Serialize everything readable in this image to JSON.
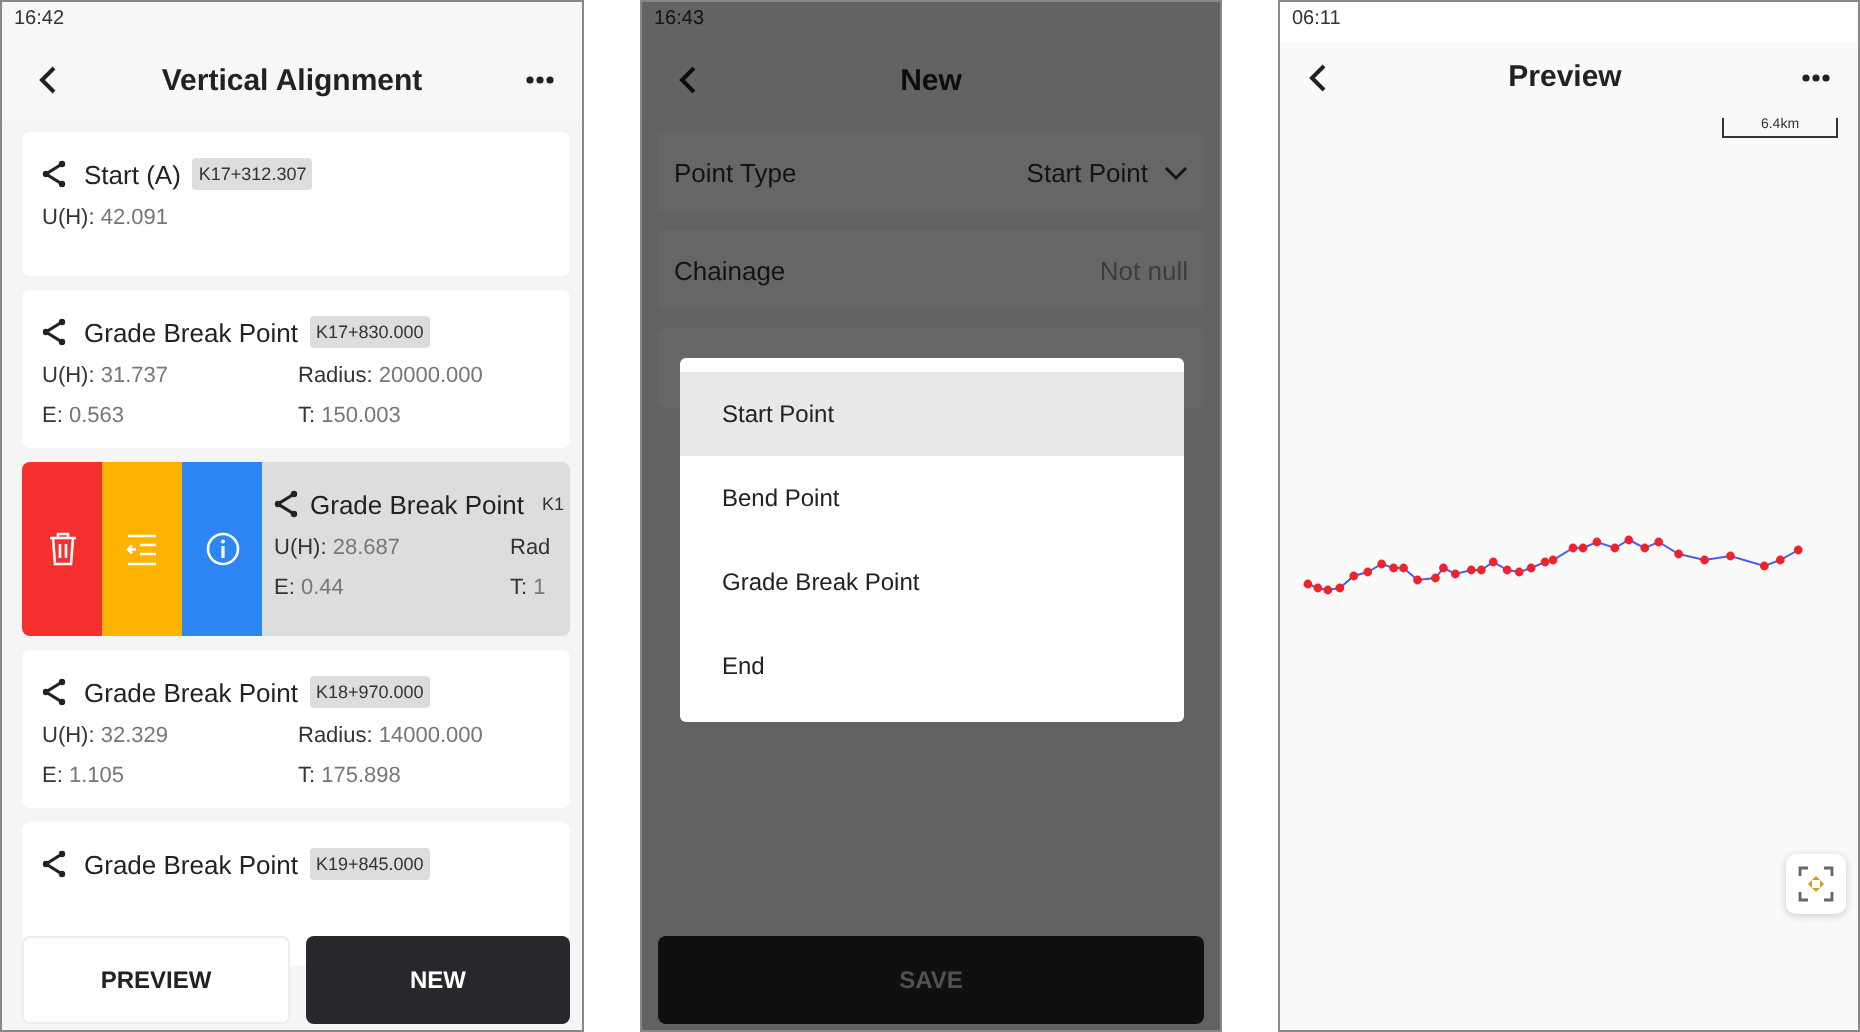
{
  "list_screen": {
    "status_time": "16:42",
    "title": "Vertical Alignment",
    "cards": [
      {
        "kind": "normal",
        "title": "Start (A)",
        "chainage": "K17+312.307",
        "fields": [
          {
            "label": "U(H):",
            "value": "42.091"
          }
        ]
      },
      {
        "kind": "normal",
        "title": "Grade Break Point",
        "chainage": "K17+830.000",
        "fields": [
          {
            "label": "U(H):",
            "value": "31.737"
          },
          {
            "label": "Radius:",
            "value": "20000.000"
          },
          {
            "label": "E:",
            "value": "0.563"
          },
          {
            "label": "T:",
            "value": "150.003"
          }
        ]
      },
      {
        "kind": "swiped",
        "title": "Grade Break Point",
        "chainage": "K1",
        "fields": [
          {
            "label": "U(H):",
            "value": "28.687"
          },
          {
            "label": "Rad"
          },
          {
            "label": "E:",
            "value": "0.44"
          },
          {
            "label": "T:",
            "value": "1"
          }
        ]
      },
      {
        "kind": "normal",
        "title": "Grade Break Point",
        "chainage": "K18+970.000",
        "fields": [
          {
            "label": "U(H):",
            "value": "32.329"
          },
          {
            "label": "Radius:",
            "value": "14000.000"
          },
          {
            "label": "E:",
            "value": "1.105"
          },
          {
            "label": "T:",
            "value": "175.898"
          }
        ]
      },
      {
        "kind": "normal",
        "title": "Grade Break Point",
        "chainage": "K19+845.000"
      }
    ],
    "buttons": [
      {
        "label": "PREVIEW",
        "kind": "secondary"
      },
      {
        "label": "NEW",
        "kind": "primary"
      }
    ]
  },
  "new_screen": {
    "status_time": "16:43",
    "title": "New",
    "fields": [
      {
        "label": "Point Type",
        "value": "Start Point",
        "kind": "select"
      },
      {
        "label": "Chainage",
        "placeholder": "Not null",
        "kind": "input"
      },
      {
        "kind": "input"
      }
    ],
    "menu": [
      {
        "label": "Start Point",
        "selected": true
      },
      {
        "label": "Bend Point",
        "selected": false
      },
      {
        "label": "Grade Break Point",
        "selected": false
      },
      {
        "label": "End",
        "selected": false
      }
    ],
    "save_button": "SAVE"
  },
  "preview_screen": {
    "status_time": "06:11",
    "title": "Preview",
    "scale": "6.4km"
  }
}
